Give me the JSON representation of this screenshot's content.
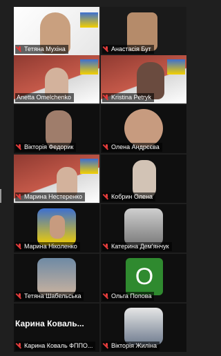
{
  "participants": [
    {
      "name": "Тетяна Мухіна"
    },
    {
      "name": "Анастасія Бут"
    },
    {
      "name": "Anetta Omelchenko"
    },
    {
      "name": "Kristina Petryk"
    },
    {
      "name": "Вікторія Федорик"
    },
    {
      "name": "Олена Андрєєва"
    },
    {
      "name": "Марина Нестеренко"
    },
    {
      "name": "Кобрин Олена"
    },
    {
      "name": "Марина Ніколенко"
    },
    {
      "name": "Катерина Дем'янчук"
    },
    {
      "name": "Тетяна Шабельська"
    },
    {
      "name": "Ольга Попова"
    },
    {
      "name": "Карина Коваль ФППО..."
    },
    {
      "name": "Вікторія Жиліна"
    }
  ],
  "center_name": "Карина Коваль...",
  "placeholder_letter": "O",
  "colors": {
    "background": "#1f1f1f",
    "active_border": "#3fbf4a",
    "muted_icon": "#e23b3b",
    "placeholder_green": "#2f8a2f"
  }
}
